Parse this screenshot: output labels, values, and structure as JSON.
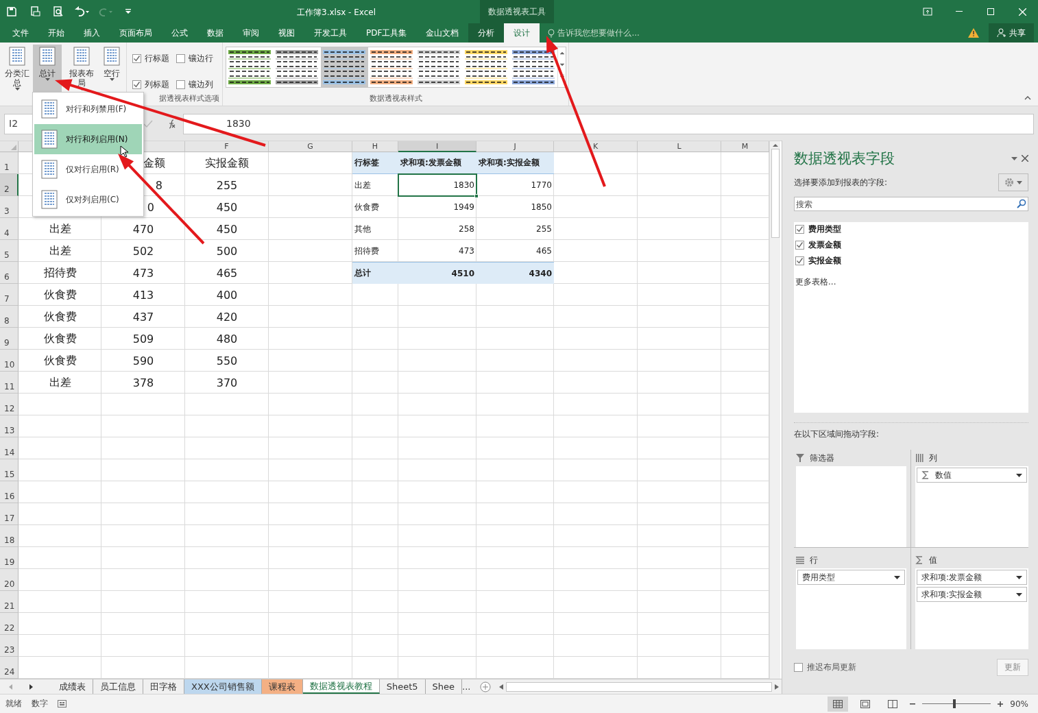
{
  "title_bar": {
    "title": "工作簿3.xlsx - Excel",
    "context_title": "数据透视表工具"
  },
  "ribbon_tabs": [
    {
      "label": "文件",
      "kind": "normal",
      "selected": false
    },
    {
      "label": "开始",
      "kind": "normal",
      "selected": false
    },
    {
      "label": "插入",
      "kind": "normal",
      "selected": false
    },
    {
      "label": "页面布局",
      "kind": "normal",
      "selected": false
    },
    {
      "label": "公式",
      "kind": "normal",
      "selected": false
    },
    {
      "label": "数据",
      "kind": "normal",
      "selected": false
    },
    {
      "label": "审阅",
      "kind": "normal",
      "selected": false
    },
    {
      "label": "视图",
      "kind": "normal",
      "selected": false
    },
    {
      "label": "开发工具",
      "kind": "normal",
      "selected": false
    },
    {
      "label": "PDF工具集",
      "kind": "normal",
      "selected": false
    },
    {
      "label": "金山文档",
      "kind": "normal",
      "selected": false
    },
    {
      "label": "分析",
      "kind": "context",
      "selected": false
    },
    {
      "label": "设计",
      "kind": "context",
      "selected": true
    }
  ],
  "tell_me": {
    "placeholder": "告诉我您想要做什么..."
  },
  "share": "共享",
  "ribbon": {
    "layout_buttons": [
      {
        "label": "分类汇总",
        "pressed": false
      },
      {
        "label": "总计",
        "pressed": true
      },
      {
        "label": "报表布局",
        "pressed": false
      },
      {
        "label": "空行",
        "pressed": false
      }
    ],
    "style_options": [
      {
        "label": "行标题",
        "checked": true
      },
      {
        "label": "镶边行",
        "checked": false
      },
      {
        "label": "列标题",
        "checked": true
      },
      {
        "label": "镶边列",
        "checked": false
      }
    ],
    "style_options_label": "据透视表样式选项",
    "styles": [
      {
        "color": "#70ad47",
        "selected": false
      },
      {
        "color": "#a5a5a5",
        "selected": false
      },
      {
        "color": "#9bc2e6",
        "selected": true
      },
      {
        "color": "#f4b183",
        "selected": false
      },
      {
        "color": "#d0d0d0",
        "selected": false
      },
      {
        "color": "#ffd966",
        "selected": false
      },
      {
        "color": "#8ea9db",
        "selected": false
      }
    ],
    "styles_label": "数据透视表样式"
  },
  "grand_total_menu": [
    {
      "label": "对行和列禁用(F)",
      "selected": false
    },
    {
      "label": "对行和列启用(N)",
      "selected": true
    },
    {
      "label": "仅对行启用(R)",
      "selected": false
    },
    {
      "label": "仅对列启用(C)",
      "selected": false
    }
  ],
  "formula_bar": {
    "name_box": "I2",
    "value": "1830"
  },
  "column_headers": [
    {
      "label": "F",
      "selected": false
    },
    {
      "label": "G",
      "selected": false
    },
    {
      "label": "H",
      "selected": false
    },
    {
      "label": "I",
      "selected": true
    },
    {
      "label": "J",
      "selected": false
    },
    {
      "label": "K",
      "selected": false
    },
    {
      "label": "L",
      "selected": false
    },
    {
      "label": "M",
      "selected": false
    }
  ],
  "row_numbers": [
    {
      "label": "1",
      "selected": false
    },
    {
      "label": "2",
      "selected": true
    },
    {
      "label": "3",
      "selected": false
    },
    {
      "label": "4",
      "selected": false
    },
    {
      "label": "5",
      "selected": false
    },
    {
      "label": "6",
      "selected": false
    },
    {
      "label": "7",
      "selected": false
    },
    {
      "label": "8",
      "selected": false
    },
    {
      "label": "9",
      "selected": false
    },
    {
      "label": "10",
      "selected": false
    },
    {
      "label": "11",
      "selected": false
    },
    {
      "label": "12",
      "selected": false
    },
    {
      "label": "13",
      "selected": false
    },
    {
      "label": "14",
      "selected": false
    },
    {
      "label": "15",
      "selected": false
    },
    {
      "label": "16",
      "selected": false
    },
    {
      "label": "17",
      "selected": false
    },
    {
      "label": "18",
      "selected": false
    },
    {
      "label": "19",
      "selected": false
    },
    {
      "label": "20",
      "selected": false
    },
    {
      "label": "21",
      "selected": false
    },
    {
      "label": "22",
      "selected": false
    },
    {
      "label": "23",
      "selected": false
    },
    {
      "label": "24",
      "selected": false
    }
  ],
  "source_rows": [
    {
      "invoice": "金额",
      "reimbursed": "实报金额"
    },
    {
      "invoice": "8",
      "reimbursed": "255"
    },
    {
      "invoice": "0",
      "reimbursed": "450"
    },
    {
      "category": "出差",
      "invoice": "470",
      "reimbursed": "450"
    },
    {
      "category": "出差",
      "invoice": "502",
      "reimbursed": "500"
    },
    {
      "category": "招待费",
      "invoice": "473",
      "reimbursed": "465"
    },
    {
      "category": "伙食费",
      "invoice": "413",
      "reimbursed": "400"
    },
    {
      "category": "伙食费",
      "invoice": "437",
      "reimbursed": "420"
    },
    {
      "category": "伙食费",
      "invoice": "509",
      "reimbursed": "480"
    },
    {
      "category": "伙食费",
      "invoice": "590",
      "reimbursed": "550"
    },
    {
      "category": "出差",
      "invoice": "378",
      "reimbursed": "370"
    }
  ],
  "pivot_table": {
    "header": [
      "行标签",
      "求和项:发票金额",
      "求和项:实报金额"
    ],
    "rows": [
      {
        "label": "出差",
        "values": [
          {
            "text": "1830",
            "selected": true
          },
          {
            "text": "1770",
            "selected": false
          }
        ]
      },
      {
        "label": "伙食费",
        "values": [
          {
            "text": "1949",
            "selected": false
          },
          {
            "text": "1850",
            "selected": false
          }
        ]
      },
      {
        "label": "其他",
        "values": [
          {
            "text": "258",
            "selected": false
          },
          {
            "text": "255",
            "selected": false
          }
        ]
      },
      {
        "label": "招待费",
        "values": [
          {
            "text": "473",
            "selected": false
          },
          {
            "text": "465",
            "selected": false
          }
        ]
      }
    ],
    "total": {
      "label": "总计",
      "values": [
        "4510",
        "4340"
      ]
    }
  },
  "field_pane": {
    "title": "数据透视表字段",
    "subtitle": "选择要添加到报表的字段:",
    "search": {
      "placeholder": "搜索"
    },
    "fields": [
      {
        "label": "费用类型",
        "checked": true
      },
      {
        "label": "发票金额",
        "checked": true
      },
      {
        "label": "实报金额",
        "checked": true
      }
    ],
    "more_tables": "更多表格...",
    "drag_hint": "在以下区域间拖动字段:",
    "areas": [
      {
        "kind": "filter",
        "label": "筛选器"
      },
      {
        "kind": "column",
        "label": "列",
        "items": [
          "数值"
        ]
      },
      {
        "kind": "row",
        "label": "行",
        "items": [
          "费用类型"
        ]
      },
      {
        "kind": "value",
        "label": "值",
        "items": [
          "求和项:发票金额",
          "求和项:实报金额"
        ]
      }
    ],
    "defer_update": {
      "label": "推迟布局更新",
      "checked": false
    },
    "update_button": "更新"
  },
  "sheet_tabs": [
    {
      "label": "成绩表",
      "selected": false
    },
    {
      "label": "员工信息",
      "selected": false
    },
    {
      "label": "田字格",
      "selected": false
    },
    {
      "label": "XXX公司销售额",
      "selected": false,
      "color": "#bdd7ee"
    },
    {
      "label": "课程表",
      "selected": false,
      "color": "#f4b084"
    },
    {
      "label": "数据透视表教程",
      "selected": true
    },
    {
      "label": "Sheet5",
      "selected": false
    },
    {
      "label": "Shee",
      "selected": false
    }
  ],
  "sheet_overflow": "...",
  "status_bar": {
    "mode": "就绪",
    "num": "数字",
    "zoom": {
      "level": 0.47,
      "reading": "90%"
    }
  }
}
